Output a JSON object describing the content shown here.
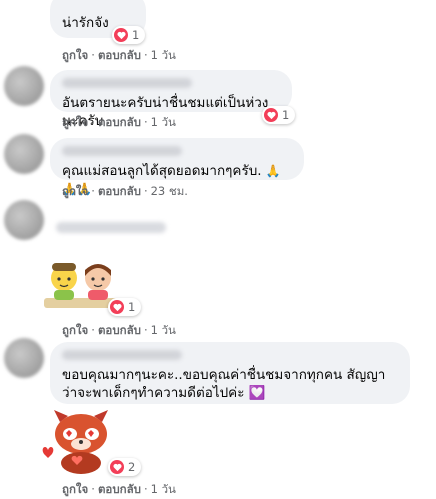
{
  "comments": [
    {
      "text": "น่ารักจัง",
      "reactions": "1",
      "like": "ถูกใจ",
      "reply": "ตอบกลับ",
      "time": "1 วัน"
    },
    {
      "text": "อันตรายนะครับน่าชื่นชมแต่เป็นห่วงนะครับ",
      "reactions": "1",
      "like": "ถูกใจ",
      "reply": "ตอบกลับ",
      "time": "1 วัน"
    },
    {
      "text": "คุณแม่สอนลูกได้สุดยอดมากๆครับ.",
      "emoji": "🙏🙏🙏",
      "like": "ถูกใจ",
      "reply": "ตอบกลับ",
      "time": "23 ชม."
    },
    {
      "reactions": "1",
      "like": "ถูกใจ",
      "reply": "ตอบกลับ",
      "time": "1 วัน"
    },
    {
      "text": "ขอบคุณมากๆนะคะ..ขอบคุณค่าชื่นชมจากทุกคน สัญญาว่าจะพาเด็กๆทำความดีต่อไปค่ะ",
      "emoji": "💟"
    },
    {
      "reactions": "2",
      "like": "ถูกใจ",
      "reply": "ตอบกลับ",
      "time": "1 วัน"
    }
  ],
  "icons": {
    "reaction": "heart-reaction-icon",
    "sticker1": "kids-sticker",
    "sticker2": "red-panda-sticker"
  },
  "colors": {
    "bubble": "#f0f2f5",
    "meta": "#65676b",
    "heart": "#f33e58"
  }
}
